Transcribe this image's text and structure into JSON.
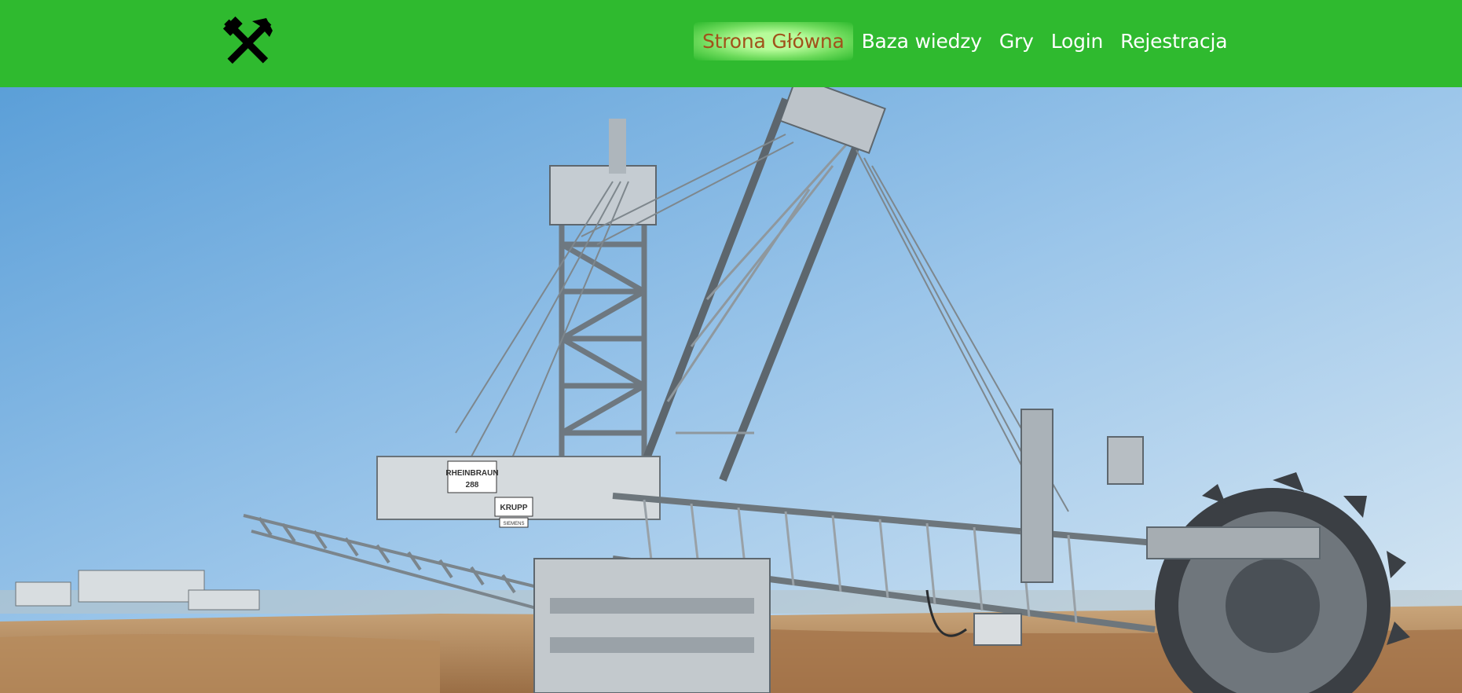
{
  "nav": {
    "logo_icon": "hammer-and-pick-icon",
    "items": [
      {
        "label": "Strona Główna",
        "active": true
      },
      {
        "label": "Baza wiedzy",
        "active": false
      },
      {
        "label": "Gry",
        "active": false
      },
      {
        "label": "Login",
        "active": false
      },
      {
        "label": "Rejestracja",
        "active": false
      }
    ]
  },
  "hero": {
    "excavator_sign": "RHEINBRAUN",
    "excavator_number": "288",
    "maker_sign": "KRUPP",
    "maker_subsign": "SIEMENS"
  },
  "colors": {
    "navbar": "#2fba2f",
    "active_link": "#a0521a",
    "link": "#ffffff"
  }
}
